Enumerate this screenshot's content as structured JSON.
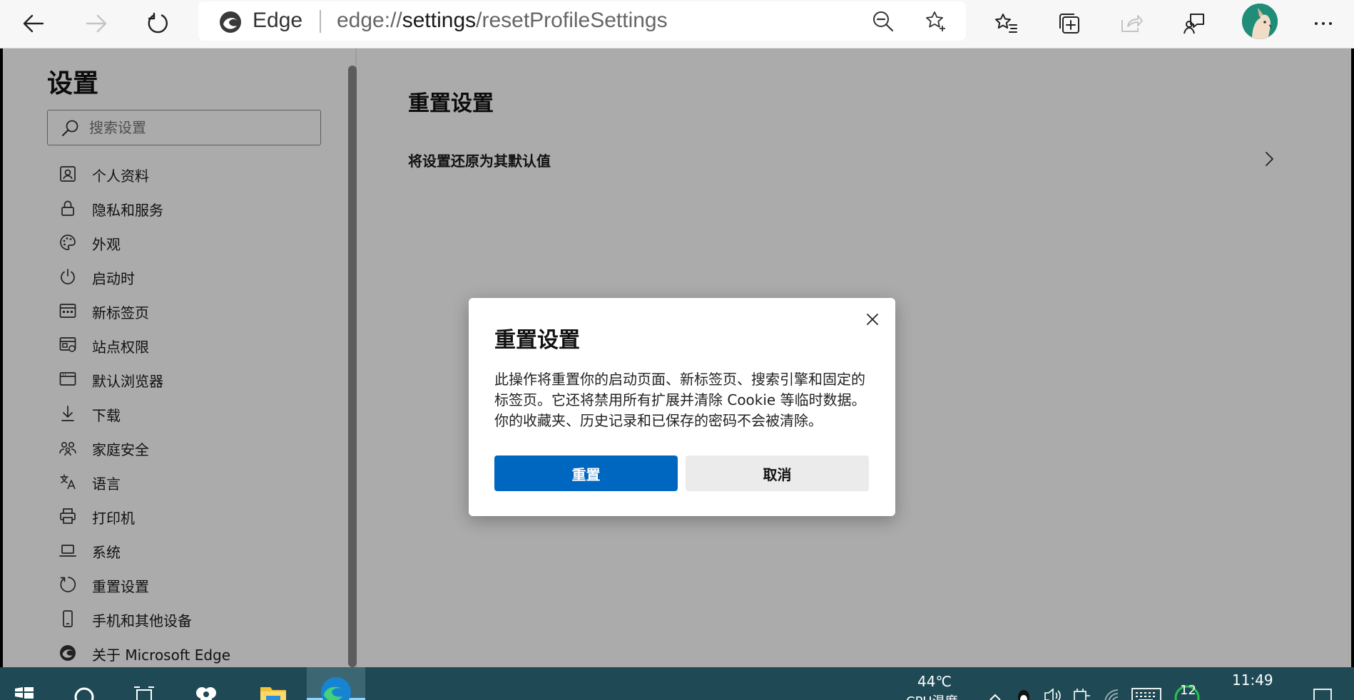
{
  "toolbar": {
    "back_icon": "arrow-left-icon",
    "forward_icon": "arrow-right-icon",
    "refresh_icon": "refresh-icon",
    "site_name": "Edge",
    "url_host": "settings",
    "url_prefix": "edge://",
    "url_path": "/resetProfileSettings",
    "zoom_icon": "zoom-out-icon",
    "favorite_icon": "star-add-icon",
    "favorites_icon": "favorites-icon",
    "collections_icon": "collections-icon",
    "share_icon": "share-icon",
    "feedback_icon": "feedback-icon",
    "more_icon": "more-icon"
  },
  "sidebar": {
    "title": "设置",
    "search_placeholder": "搜索设置",
    "items": [
      {
        "label": "个人资料",
        "icon": "profile-icon"
      },
      {
        "label": "隐私和服务",
        "icon": "lock-icon"
      },
      {
        "label": "外观",
        "icon": "palette-icon"
      },
      {
        "label": "启动时",
        "icon": "power-icon"
      },
      {
        "label": "新标签页",
        "icon": "new-tab-icon"
      },
      {
        "label": "站点权限",
        "icon": "site-permissions-icon"
      },
      {
        "label": "默认浏览器",
        "icon": "default-browser-icon"
      },
      {
        "label": "下载",
        "icon": "download-icon"
      },
      {
        "label": "家庭安全",
        "icon": "family-icon"
      },
      {
        "label": "语言",
        "icon": "language-icon"
      },
      {
        "label": "打印机",
        "icon": "printer-icon"
      },
      {
        "label": "系统",
        "icon": "laptop-icon"
      },
      {
        "label": "重置设置",
        "icon": "reset-icon"
      },
      {
        "label": "手机和其他设备",
        "icon": "phone-icon"
      },
      {
        "label": "关于 Microsoft Edge",
        "icon": "edge-icon"
      }
    ]
  },
  "content": {
    "title": "重置设置",
    "row_label": "将设置还原为其默认值"
  },
  "dialog": {
    "title": "重置设置",
    "body": "此操作将重置你的启动页面、新标签页、搜索引擎和固定的标签页。它还将禁用所有扩展并清除 Cookie 等临时数据。你的收藏夹、历史记录和已保存的密码不会被清除。",
    "primary_label": "重置",
    "secondary_label": "取消",
    "accent_color": "#0067c0"
  },
  "taskbar": {
    "temperature": "44℃",
    "weather_partial": "CPU温度",
    "time": "11:49",
    "badge": "12"
  }
}
